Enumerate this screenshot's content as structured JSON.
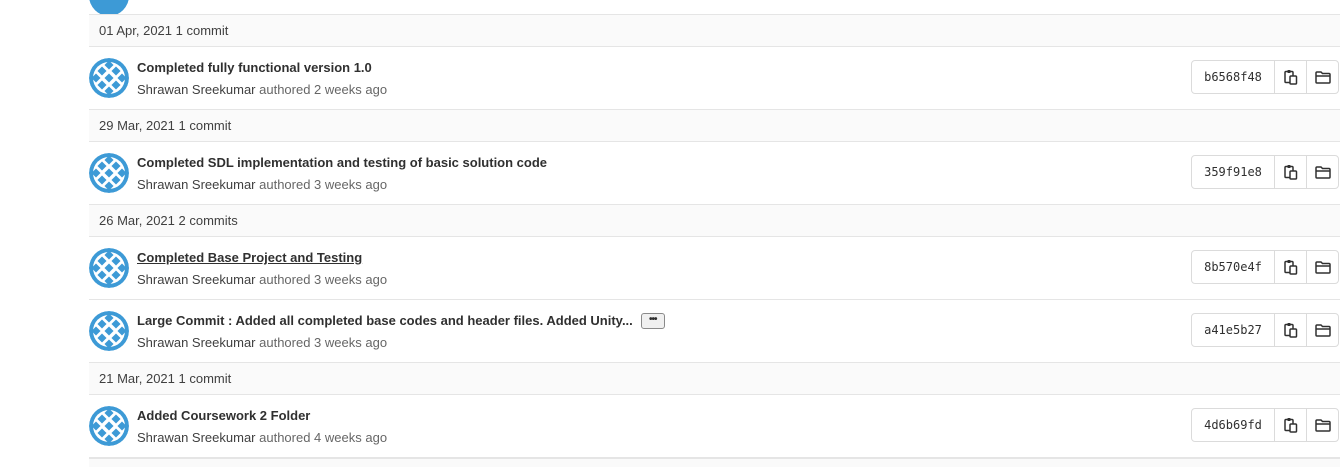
{
  "groups": [
    {
      "header": "01 Apr, 2021 1 commit",
      "commits": [
        {
          "title": "Completed fully functional version 1.0",
          "author": "Shrawan Sreekumar",
          "authored": "authored 2 weeks ago",
          "sha": "b6568f48",
          "has_ellipsis": false,
          "underlined": false
        }
      ]
    },
    {
      "header": "29 Mar, 2021 1 commit",
      "commits": [
        {
          "title": "Completed SDL implementation and testing of basic solution code",
          "author": "Shrawan Sreekumar",
          "authored": "authored 3 weeks ago",
          "sha": "359f91e8",
          "has_ellipsis": false,
          "underlined": false
        }
      ]
    },
    {
      "header": "26 Mar, 2021 2 commits",
      "commits": [
        {
          "title": "Completed Base Project and Testing",
          "author": "Shrawan Sreekumar",
          "authored": "authored 3 weeks ago",
          "sha": "8b570e4f",
          "has_ellipsis": false,
          "underlined": true
        },
        {
          "title": "Large Commit : Added all completed base codes and header files. Added Unity...",
          "author": "Shrawan Sreekumar",
          "authored": "authored 3 weeks ago",
          "sha": "a41e5b27",
          "has_ellipsis": true,
          "underlined": false
        }
      ]
    },
    {
      "header": "21 Mar, 2021 1 commit",
      "commits": [
        {
          "title": "Added Coursework 2 Folder",
          "author": "Shrawan Sreekumar",
          "authored": "authored 4 weeks ago",
          "sha": "4d6b69fd",
          "has_ellipsis": false,
          "underlined": false
        }
      ]
    }
  ],
  "ellipsis_label": "•••",
  "icons": {
    "copy": "clipboard-icon",
    "browse": "folder-icon",
    "avatar": "identicon-avatar"
  },
  "colors": {
    "avatar": "#3d9ad6",
    "header_bg": "#fafafa",
    "border": "#e5e5e5"
  }
}
